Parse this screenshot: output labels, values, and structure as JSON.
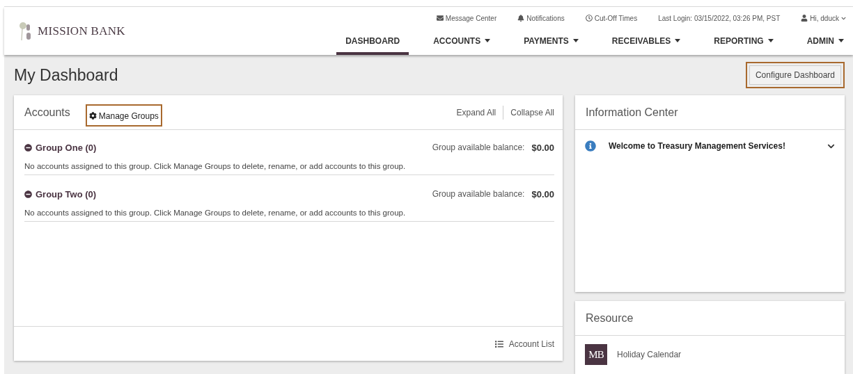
{
  "header": {
    "logo": "MISSION BANK",
    "utility": [
      {
        "kind": "mail",
        "label": "Message Center"
      },
      {
        "kind": "bell",
        "label": "Notifications"
      },
      {
        "kind": "clock",
        "label": "Cut-Off Times"
      },
      {
        "kind": "text",
        "label": "Last Login: 03/15/2022, 03:26 PM, PST"
      },
      {
        "kind": "user",
        "label": "Hi, dduck"
      }
    ],
    "nav": [
      {
        "label": "DASHBOARD",
        "selected": true,
        "menu": false
      },
      {
        "label": "ACCOUNTS",
        "selected": false,
        "menu": true
      },
      {
        "label": "PAYMENTS",
        "selected": false,
        "menu": true
      },
      {
        "label": "RECEIVABLES",
        "selected": false,
        "menu": true
      },
      {
        "label": "REPORTING",
        "selected": false,
        "menu": true
      },
      {
        "label": "ADMIN",
        "selected": false,
        "menu": true
      }
    ]
  },
  "page": {
    "title": "My Dashboard",
    "configure_button": "Configure Dashboard"
  },
  "accounts": {
    "title": "Accounts",
    "manage_groups": "Manage Groups",
    "expand_all": "Expand All",
    "collapse_all": "Collapse All",
    "groups": [
      {
        "name": "Group One (0)",
        "balance_label": "Group available balance:",
        "balance": "$0.00",
        "expanded": true,
        "message": "No accounts assigned to this group. Click Manage Groups to delete, rename, or add accounts to this group."
      },
      {
        "name": "Group Two (0)",
        "balance_label": "Group available balance:",
        "balance": "$0.00",
        "expanded": true,
        "message": "No accounts assigned to this group. Click Manage Groups to delete, rename, or add accounts to this group."
      }
    ],
    "account_list": "Account List"
  },
  "information_center": {
    "title": "Information Center",
    "items": [
      {
        "text": "Welcome to Treasury Management Services!",
        "expanded": false
      }
    ]
  },
  "resource": {
    "title": "Resource",
    "items": [
      {
        "badge": "MB",
        "label": "Holiday Calendar"
      }
    ]
  }
}
